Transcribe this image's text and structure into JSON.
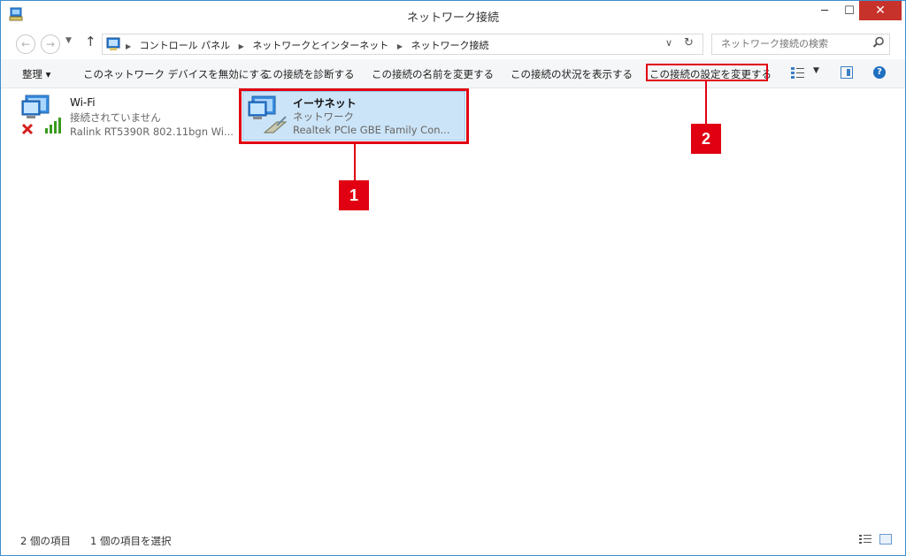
{
  "window": {
    "title": "ネットワーク接続",
    "controls": {
      "minimize": "─",
      "maximize": "☐",
      "close": "✕"
    }
  },
  "address": {
    "breadcrumbs": [
      "コントロール パネル",
      "ネットワークとインターネット",
      "ネットワーク接続"
    ],
    "separator": "▶",
    "search_placeholder": "ネットワーク接続の検索"
  },
  "commands": {
    "organize": "整理 ▾",
    "disable": "このネットワーク デバイスを無効にする",
    "diagnose": "この接続を診断する",
    "rename": "この接続の名前を変更する",
    "status": "この接続の状況を表示する",
    "settings": "この接続の設定を変更する"
  },
  "connections": [
    {
      "name": "Wi-Fi",
      "status": "接続されていません",
      "device": "Ralink RT5390R 802.11bgn Wi..."
    },
    {
      "name": "イーサネット",
      "status": "ネットワーク",
      "device": "Realtek PCIe GBE Family Con..."
    }
  ],
  "callouts": [
    "1",
    "2"
  ],
  "statusbar": {
    "count": "2 個の項目",
    "selected": "1 個の項目を選択"
  },
  "colors": {
    "accent": "#e00012",
    "selection": "#cce4f7",
    "close_button": "#c7322b"
  }
}
